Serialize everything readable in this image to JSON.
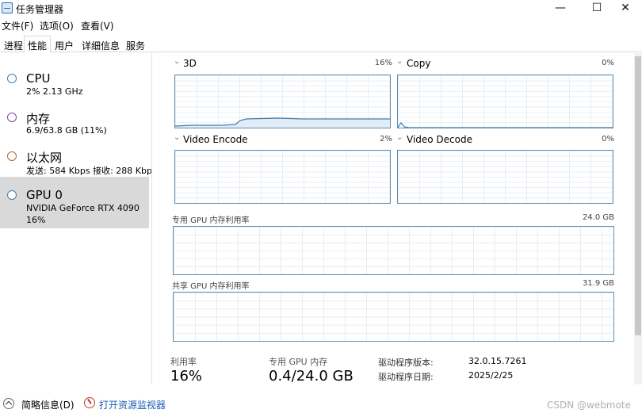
{
  "window": {
    "title": "任务管理器",
    "minimize": "—",
    "maximize": "☐",
    "close": "✕"
  },
  "menu": [
    "文件(F)",
    "选项(O)",
    "查看(V)"
  ],
  "tabs": [
    "进程",
    "性能",
    "用户",
    "详细信息",
    "服务"
  ],
  "sidebar": {
    "items": [
      {
        "name": "CPU",
        "sub": "2%  2.13 GHz",
        "color": "#3c7fb1"
      },
      {
        "name": "内存",
        "sub": "6.9/63.8 GB (11%)",
        "color": "#8b3fa5"
      },
      {
        "name": "以太网",
        "sub": "发送: 584 Kbps  接收: 288 Kbps",
        "color": "#b5651d"
      },
      {
        "name": "GPU 0",
        "sub": "NVIDIA GeForce RTX 4090",
        "sub2": "16%",
        "color": "#3c7fb1"
      }
    ]
  },
  "graphs": {
    "g3d": {
      "label": "3D",
      "percent": "16%",
      "level": 0.12
    },
    "copy": {
      "label": "Copy",
      "percent": "0%",
      "level": 0.0
    },
    "encode": {
      "label": "Video Encode",
      "percent": "2%",
      "level": 0.0
    },
    "decode": {
      "label": "Video Decode",
      "percent": "0%",
      "level": 0.0
    },
    "dedicated": {
      "label": "专用 GPU 内存利用率",
      "max": "24.0 GB"
    },
    "shared": {
      "label": "共享 GPU 内存利用率",
      "max": "31.9 GB"
    }
  },
  "stats": {
    "util_label": "利用率",
    "util_value": "16%",
    "mem_label": "专用 GPU 内存",
    "mem_value": "0.4/24.0 GB",
    "driver_version_label": "驱动程序版本:",
    "driver_version": "32.0.15.7261",
    "driver_date_label": "驱动程序日期:",
    "driver_date": "2025/2/25"
  },
  "footer": {
    "brief": "简略信息(D)",
    "open_monitor": "打开资源监视器",
    "watermark": "CSDN @webmote"
  },
  "colors": {
    "graph_border": "#5c8fb3",
    "graph_line": "#3c7fb1",
    "link": "#1a5fb4"
  }
}
